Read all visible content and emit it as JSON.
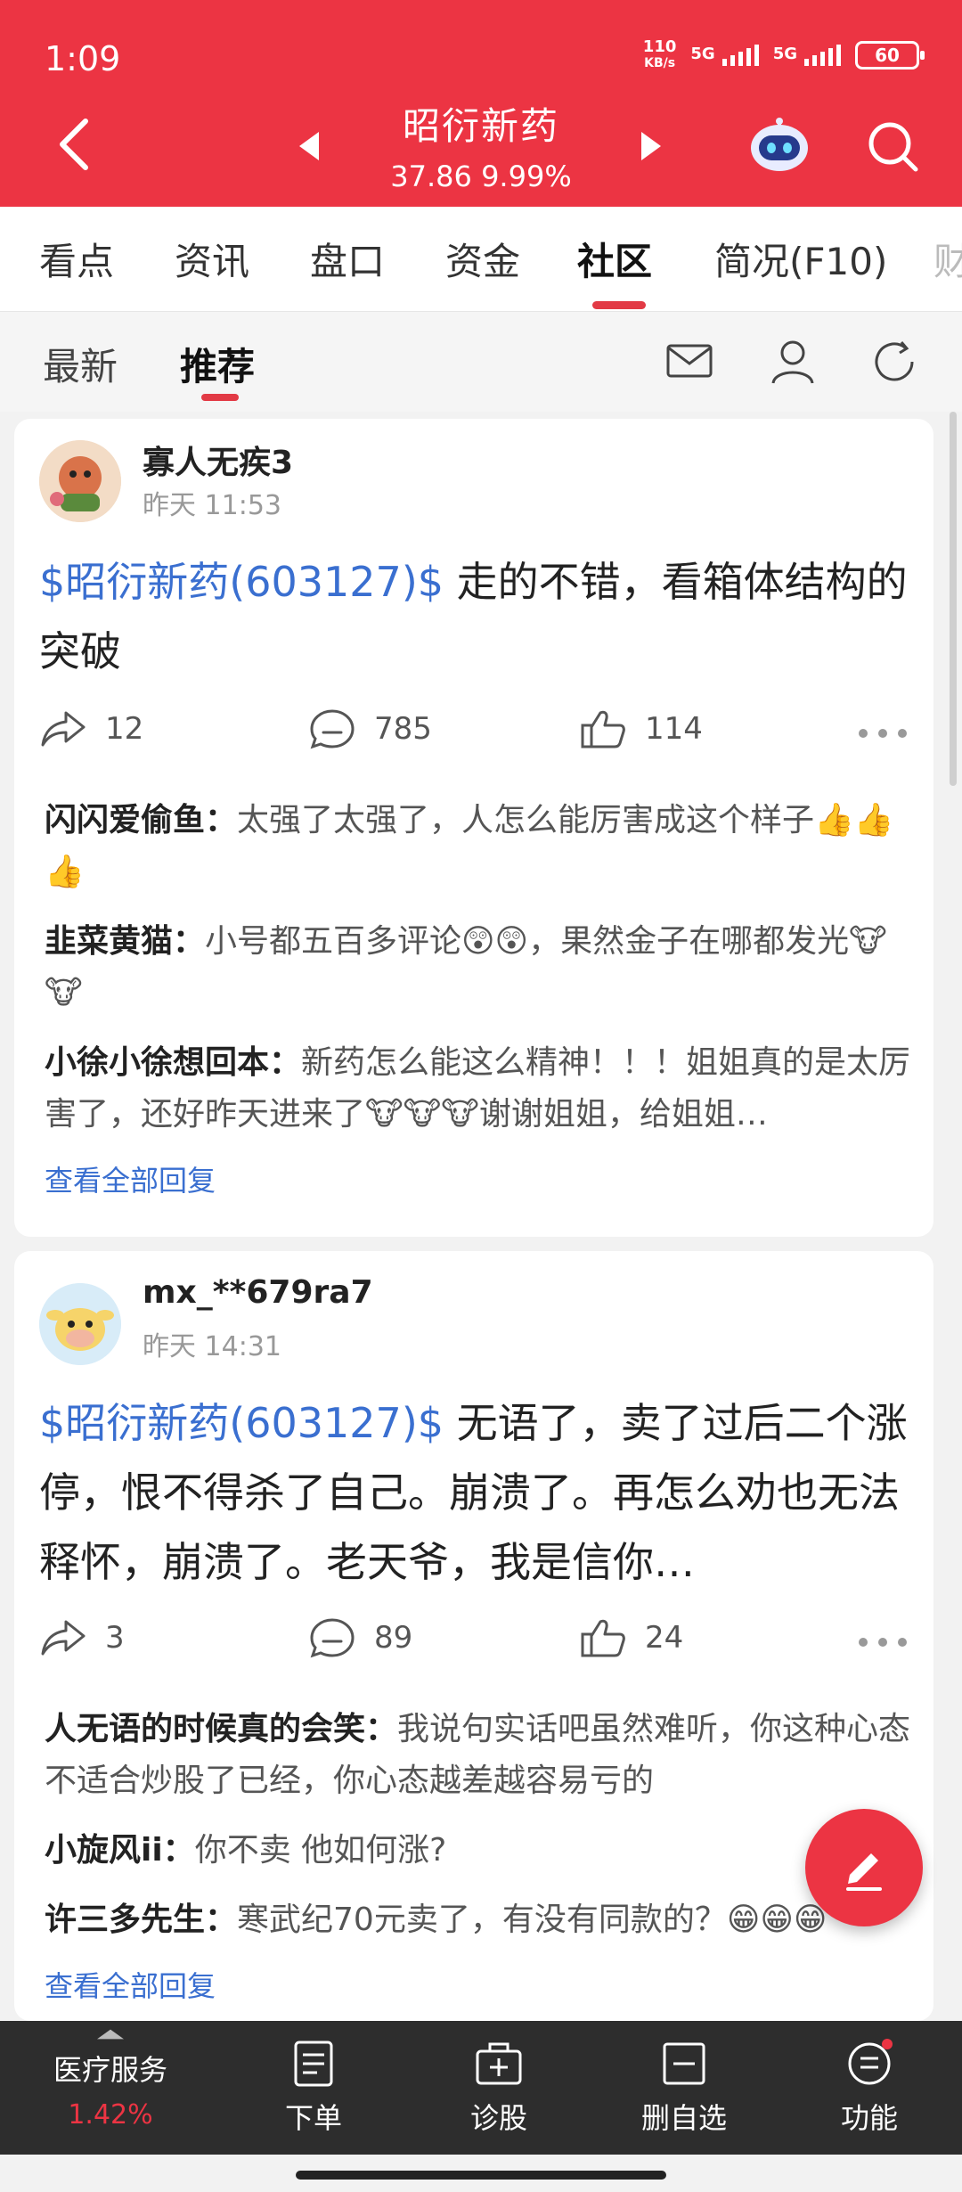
{
  "status": {
    "time": "1:09",
    "netspeed_value": "110",
    "netspeed_unit": "KB/s",
    "sim1": "5G",
    "sim2": "5G",
    "battery": "60"
  },
  "header": {
    "title": "昭衍新药",
    "price_line": "37.86  9.99%"
  },
  "tabs": [
    "看点",
    "资讯",
    "盘口",
    "资金",
    "社区",
    "简况(F10)",
    "财"
  ],
  "active_tab": "社区",
  "subtabs": [
    "最新",
    "推荐"
  ],
  "active_subtab": "推荐",
  "posts": [
    {
      "user": "寡人无疾3",
      "time": "昨天 11:53",
      "stock": "$昭衍新药(603127)$",
      "text": " 走的不错，看箱体结构的突破",
      "share": "12",
      "comments": "785",
      "likes": "114",
      "replies": [
        {
          "user": "闪闪爱偷鱼：",
          "text": "太强了太强了，人怎么能厉害成这个样子👍👍👍"
        },
        {
          "user": "韭菜黄猫：",
          "text": "小号都五百多评论😲😲，果然金子在哪都发光🐮🐮"
        },
        {
          "user": "小徐小徐想回本：",
          "text": "新药怎么能这么精神！！！姐姐真的是太厉害了，还好昨天进来了🐮🐮🐮谢谢姐姐，给姐姐…"
        }
      ],
      "view_all": "查看全部回复"
    },
    {
      "user": "mx_**679ra7",
      "time": "昨天 14:31",
      "stock": "$昭衍新药(603127)$",
      "text": " 无语了，卖了过后二个涨停，恨不得杀了自己。崩溃了。再怎么劝也无法释怀，崩溃了。老天爷，我是信你…",
      "share": "3",
      "comments": "89",
      "likes": "24",
      "replies": [
        {
          "user": "人无语的时候真的会笑：",
          "text": "我说句实话吧虽然难听，你这种心态不适合炒股了已经，你心态越差越容易亏的"
        },
        {
          "user": "小旋风ii：",
          "text": "你不卖 他如何涨?"
        },
        {
          "user": "许三多先生：",
          "text": "寒武纪70元卖了，有没有同款的？😁😁😁"
        }
      ],
      "view_all": "查看全部回复"
    }
  ],
  "bottom": {
    "sector_name": "医疗服务",
    "sector_change": "1.42%",
    "items": [
      "下单",
      "诊股",
      "删自选",
      "功能"
    ]
  },
  "colors": {
    "brand_red": "#ec3443",
    "link_blue": "#3a6fd0"
  }
}
